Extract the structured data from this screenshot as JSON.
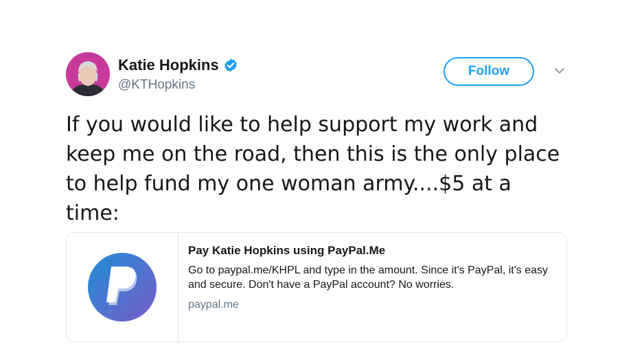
{
  "author": {
    "display_name": "Katie Hopkins",
    "handle": "@KTHopkins",
    "verified": true,
    "avatar_bg": "#c8399c"
  },
  "actions": {
    "follow_label": "Follow",
    "menu_icon": "chevron-down-icon"
  },
  "tweet": {
    "text": "If you would like to help support my work and keep me on the road, then this is the only place to help fund my one woman army....$5 at a time:"
  },
  "card": {
    "icon": "paypal-logo",
    "title": "Pay Katie Hopkins using PayPal.Me",
    "description": "Go to paypal.me/KHPL and type in the amount. Since it's PayPal, it's easy and secure. Don't have a PayPal account? No worries.",
    "domain": "paypal.me"
  },
  "colors": {
    "accent": "#1da1f2",
    "secondary_text": "#657786",
    "border": "#e1e8ed"
  }
}
